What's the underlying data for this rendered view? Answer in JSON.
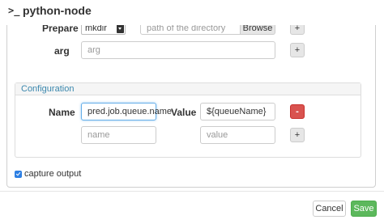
{
  "header": {
    "icon": "terminal-prompt-icon",
    "icon_glyph": ">_",
    "title": "python-node"
  },
  "prepare": {
    "label": "Prepare",
    "select_value": "mkdir",
    "path_placeholder": "path of the directory",
    "browse_label": "Browse",
    "add_label": "+"
  },
  "arg": {
    "label": "arg",
    "placeholder": "arg",
    "add_label": "+"
  },
  "configuration": {
    "title": "Configuration",
    "name_label": "Name",
    "value_label": "Value",
    "rows": [
      {
        "name": "pred.job.queue.name",
        "value": "${queueName}",
        "action_label": "-"
      }
    ],
    "new_row": {
      "name_placeholder": "name",
      "value_placeholder": "value",
      "action_label": "+"
    }
  },
  "capture_output": {
    "label": "capture output",
    "checked": true
  },
  "footer": {
    "cancel_label": "Cancel",
    "save_label": "Save"
  },
  "colors": {
    "save_button": "#5cb85c",
    "remove_button": "#d9534f",
    "section_title": "#3a87ad",
    "checkbox": "#2d7fe3"
  }
}
